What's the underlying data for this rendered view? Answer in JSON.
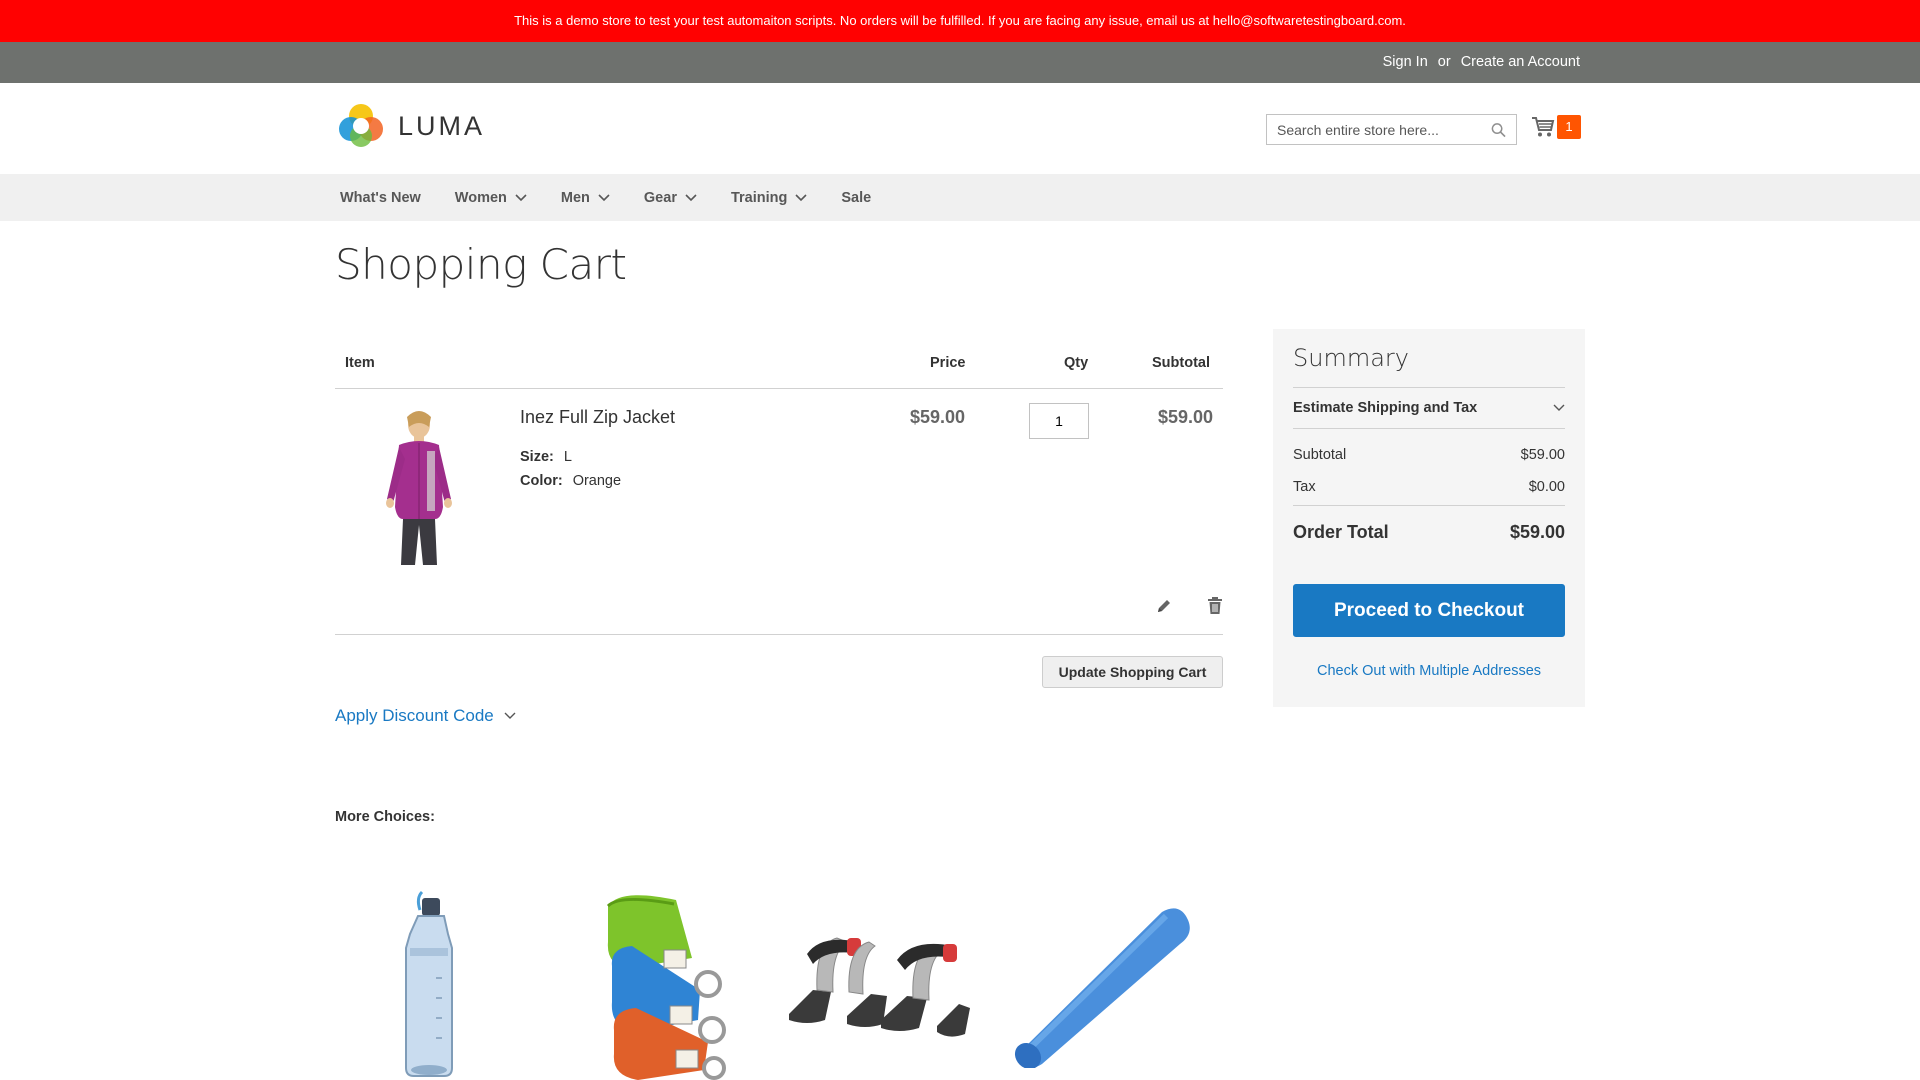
{
  "banner": {
    "text": "This is a demo store to test your test automaiton scripts. No orders will be fulfilled. If you are facing any issue, email us at hello@softwaretestingboard.com."
  },
  "header_links": {
    "sign_in": "Sign In",
    "or": "or",
    "create_account": "Create an Account"
  },
  "logo": {
    "text": "LUMA"
  },
  "search": {
    "placeholder": "Search entire store here..."
  },
  "minicart": {
    "count": "1"
  },
  "nav": {
    "items": [
      {
        "label": "What's New",
        "has_dropdown": false
      },
      {
        "label": "Women",
        "has_dropdown": true
      },
      {
        "label": "Men",
        "has_dropdown": true
      },
      {
        "label": "Gear",
        "has_dropdown": true
      },
      {
        "label": "Training",
        "has_dropdown": true
      },
      {
        "label": "Sale",
        "has_dropdown": false
      }
    ]
  },
  "page": {
    "title": "Shopping Cart"
  },
  "cart": {
    "headers": {
      "item": "Item",
      "price": "Price",
      "qty": "Qty",
      "subtotal": "Subtotal"
    },
    "items": [
      {
        "name": "Inez Full Zip Jacket",
        "options": [
          {
            "label": "Size:",
            "value": "L"
          },
          {
            "label": "Color:",
            "value": "Orange"
          }
        ],
        "price": "$59.00",
        "qty": "1",
        "subtotal": "$59.00",
        "image_icon": "jacket-image"
      }
    ],
    "update_label": "Update Shopping Cart"
  },
  "discount": {
    "label": "Apply Discount Code"
  },
  "more_choices": {
    "title": "More Choices:",
    "products": [
      {
        "icon": "water-bottle-image"
      },
      {
        "icon": "yoga-strap-image"
      },
      {
        "icon": "push-up-grips-image"
      },
      {
        "icon": "foam-roller-image"
      }
    ]
  },
  "summary": {
    "title": "Summary",
    "estimate_label": "Estimate Shipping and Tax",
    "subtotal_label": "Subtotal",
    "subtotal_value": "$59.00",
    "tax_label": "Tax",
    "tax_value": "$0.00",
    "total_label": "Order Total",
    "total_value": "$59.00",
    "checkout_label": "Proceed to Checkout",
    "multi_label": "Check Out with Multiple Addresses"
  },
  "colors": {
    "banner": "#ff0101",
    "header_bar": "#6e716e",
    "accent": "#1979c3",
    "cart_badge": "#ff5501"
  }
}
